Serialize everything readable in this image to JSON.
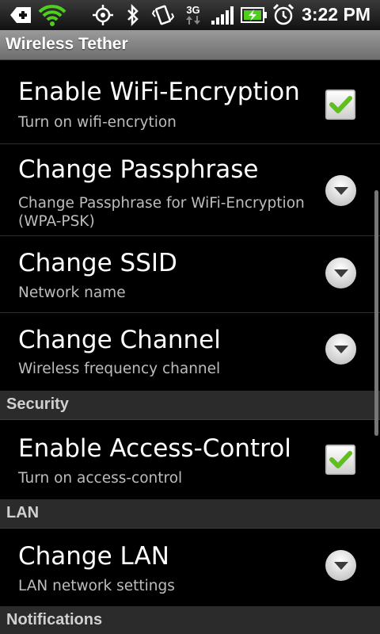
{
  "status_bar": {
    "time": "3:22 PM",
    "network": "3G",
    "icons": [
      "usb-debug-icon",
      "wifi-icon",
      "gps-icon",
      "bluetooth-icon",
      "vibrate-icon",
      "network-3g-icon",
      "signal-icon",
      "battery-charging-icon",
      "alarm-icon"
    ]
  },
  "app_title": "Wireless Tether",
  "preferences": [
    {
      "title": "Enable WiFi-Encryption",
      "summary": "Turn on wifi-encrytion",
      "widget": "checkbox",
      "checked": true
    },
    {
      "title": "Change Passphrase",
      "summary": "Change Passphrase for WiFi-Encryption (WPA-PSK)",
      "widget": "dropdown"
    },
    {
      "title": "Change SSID",
      "summary": "Network name",
      "widget": "dropdown"
    },
    {
      "title": "Change Channel",
      "summary": "Wireless frequency channel",
      "widget": "dropdown"
    }
  ],
  "security": {
    "header": "Security",
    "items": [
      {
        "title": "Enable Access-Control",
        "summary": "Turn on access-control",
        "widget": "checkbox",
        "checked": true
      }
    ]
  },
  "lan": {
    "header": "LAN",
    "items": [
      {
        "title": "Change LAN",
        "summary": "LAN network settings",
        "widget": "dropdown"
      }
    ]
  },
  "notifications": {
    "header": "Notifications"
  },
  "colors": {
    "accent_check": "#5fbf1f",
    "background": "#000000"
  }
}
